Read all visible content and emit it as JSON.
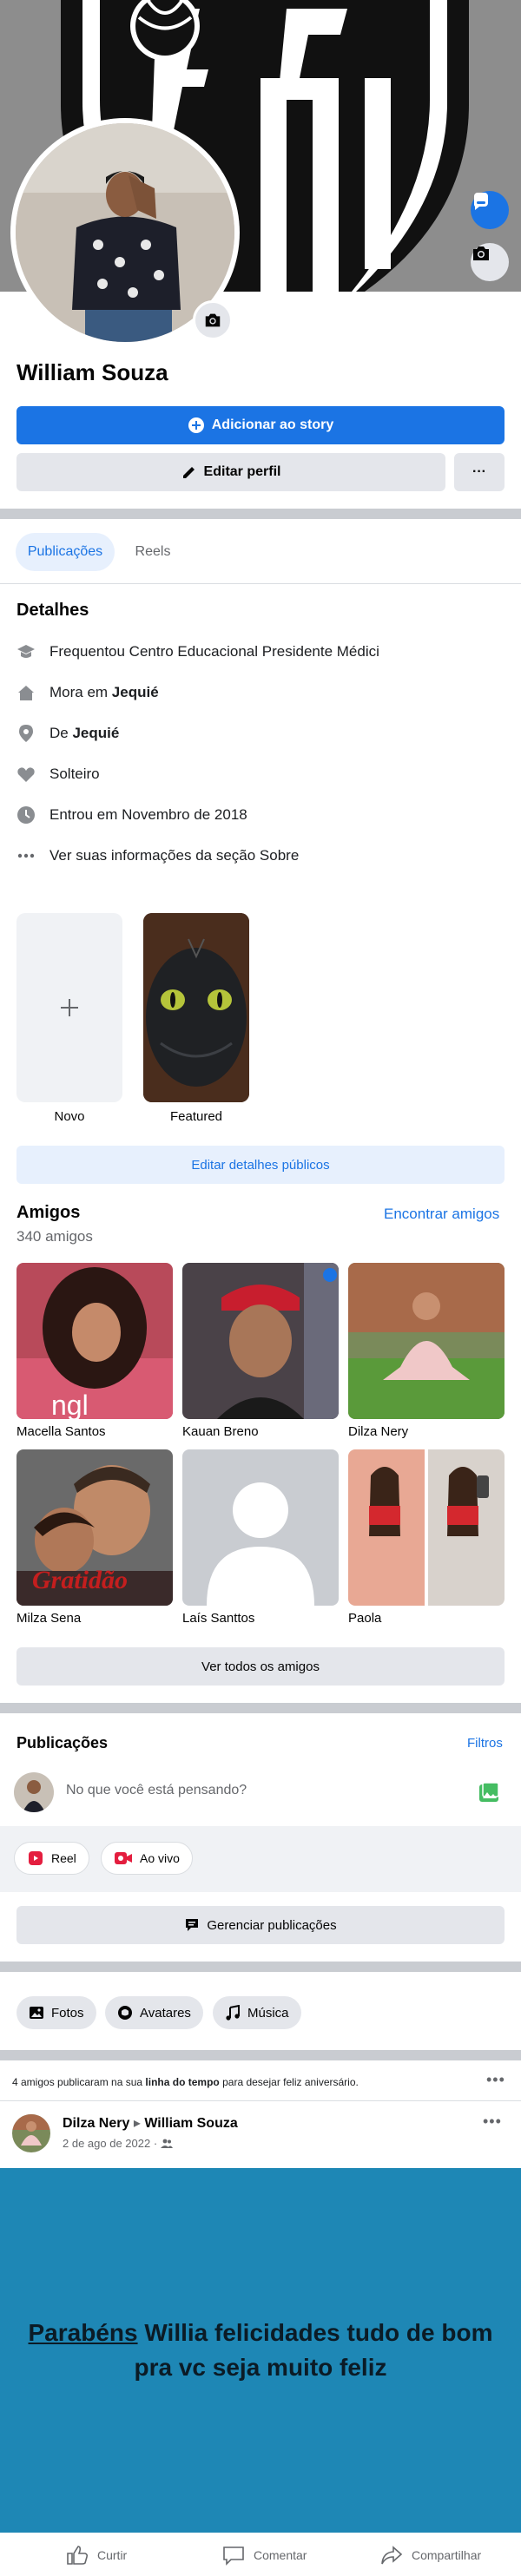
{
  "profile": {
    "name": "William Souza",
    "add_story_label": "Adicionar ao story",
    "edit_profile_label": "Editar perfil",
    "more_label": "···"
  },
  "tabs": {
    "posts": "Publicações",
    "reels": "Reels"
  },
  "details": {
    "title": "Detalhes",
    "studied_label": "Frequentou Centro Educacional Presidente Médici",
    "lives_prefix": "Mora em ",
    "lives_city": "Jequié",
    "from_prefix": "De ",
    "from_city": "Jequié",
    "relationship": "Solteiro",
    "joined": "Entrou em Novembro de 2018",
    "about_link": "Ver suas informações da seção Sobre"
  },
  "featured": {
    "new_label": "Novo",
    "featured_label": "Featured",
    "edit_public_label": "Editar detalhes públicos"
  },
  "friends": {
    "title": "Amigos",
    "count": "340 amigos",
    "find_label": "Encontrar amigos",
    "list": [
      {
        "name": "Macella Santos"
      },
      {
        "name": "Kauan Breno"
      },
      {
        "name": "Dilza Nery"
      },
      {
        "name": "Milza Sena"
      },
      {
        "name": "Laís Santtos"
      },
      {
        "name": "Paola"
      }
    ],
    "gratitude_text": "Gratidão",
    "see_all_label": "Ver todos os amigos"
  },
  "posts": {
    "title": "Publicações",
    "filters_label": "Filtros",
    "composer_placeholder": "No que você está pensando?",
    "reel_label": "Reel",
    "live_label": "Ao vivo",
    "manage_label": "Gerenciar publicações",
    "photos_chip": "Fotos",
    "avatars_chip": "Avatares",
    "music_chip": "Música"
  },
  "birthday": {
    "summary_prefix": "4 amigos publicaram na sua ",
    "summary_bold": "linha do tempo",
    "summary_suffix": " para desejar feliz aniversário.",
    "author": "Dilza Nery",
    "arrow": "▸",
    "target": "William Souza",
    "date": "2 de ago de 2022 ·",
    "message_underlined": "Parabéns",
    "message_rest": " Willia felicidades tudo de bom pra vc seja muito feliz"
  },
  "actions": {
    "like": "Curtir",
    "comment": "Comentar",
    "share": "Compartilhar"
  },
  "colors": {
    "accent": "#1b74e4",
    "post_bg": "#1e87b5",
    "divider": "#c9ccd1"
  }
}
